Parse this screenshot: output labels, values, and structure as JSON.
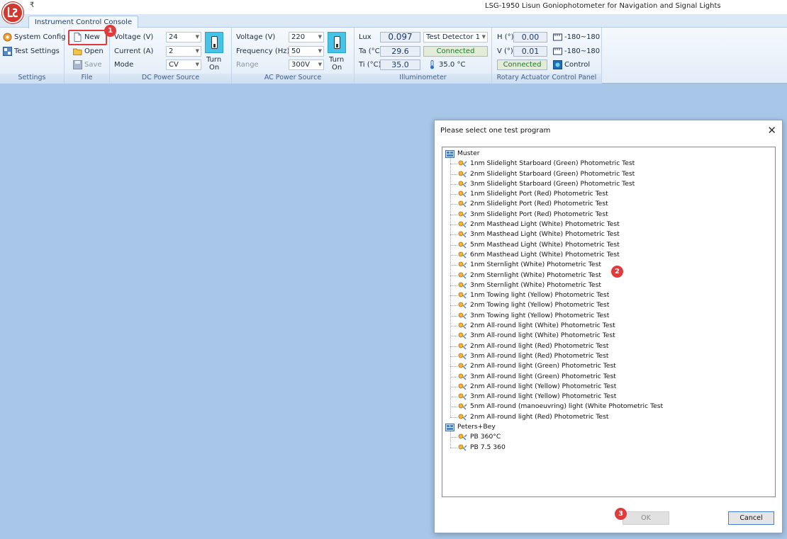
{
  "window": {
    "title": "LSG-1950 Lisun Goniophotometer for Navigation and Signal Lights",
    "qat_glyph": "₹",
    "active_tab": "Instrument Control Console"
  },
  "ribbon": {
    "settings": {
      "label": "Settings",
      "system_config": "System Config",
      "test_settings": "Test Settings"
    },
    "file": {
      "label": "File",
      "new": "New",
      "open": "Open",
      "save": "Save"
    },
    "dc_power": {
      "label": "DC Power Source",
      "voltage_label": "Voltage (V)",
      "voltage_value": "24",
      "current_label": "Current (A)",
      "current_value": "2",
      "mode_label": "Mode",
      "mode_value": "CV",
      "toggle_line1": "Turn",
      "toggle_line2": "On"
    },
    "ac_power": {
      "label": "AC Power Source",
      "voltage_label": "Voltage (V)",
      "voltage_value": "220",
      "frequency_label": "Frequency (Hz)",
      "frequency_value": "50",
      "range_label": "Range",
      "range_value": "300V",
      "toggle_line1": "Turn",
      "toggle_line2": "On"
    },
    "illuminometer": {
      "label": "Illuminometer",
      "lux_label": "Lux",
      "lux_value": "0.097",
      "ta_label": "Ta (°C)",
      "ta_value": "29.6",
      "ti_label": "Ti (°C)",
      "ti_value": "35.0",
      "detector_value": "Test Detector 1",
      "status": "Connected",
      "temp_reading": "35.0 °C"
    },
    "rotary": {
      "label": "Rotary Actuator Control Panel",
      "h_label": "H (°)",
      "h_value": "0.00",
      "h_range": "-180~180",
      "v_label": "V (°)",
      "v_value": "0.01",
      "v_range": "-180~180",
      "status": "Connected",
      "control": "Control"
    }
  },
  "annotations": {
    "step1": "1",
    "step2": "2",
    "step3": "3"
  },
  "dialog": {
    "title": "Please select one test program",
    "close_glyph": "✕",
    "groups": [
      {
        "name": "Muster",
        "items": [
          "1nm Slidelight Starboard (Green) Photometric Test",
          "2nm Slidelight Starboard (Green) Photometric Test",
          "3nm Slidelight Starboard (Green) Photometric Test",
          "1nm Slidelight Port (Red) Photometric Test",
          "2nm Slidelight Port (Red) Photometric Test",
          "3nm Slidelight Port (Red) Photometric Test",
          "2nm Masthead Light (White) Photometric Test",
          "3nm Masthead Light (White) Photometric Test",
          "5nm Masthead Light (White) Photometric Test",
          "6nm Masthead Light (White) Photometric Test",
          "1nm Sternlight  (White) Photometric Test",
          "2nm Sternlight  (White) Photometric Test",
          "3nm Sternlight  (White) Photometric Test",
          "1nm Towing light (Yellow) Photometric Test",
          "2nm Towing light (Yellow) Photometric Test",
          "3nm Towing light (Yellow) Photometric Test",
          "2nm All-round light (White) Photometric Test",
          "3nm All-round light (White) Photometric Test",
          "2nm All-round light (Red) Photometric Test",
          "3nm All-round light (Red) Photometric Test",
          "2nm All-round light (Green) Photometric Test",
          "3nm All-round light (Green) Photometric Test",
          "2nm All-round light (Yellow) Photometric Test",
          "3nm All-round light (Yellow) Photometric Test",
          "5nm All-round (manoeuvring) light (White Photometric Test",
          "2nm All-round light (Red) Photometric Test"
        ]
      },
      {
        "name": "Peters+Bey",
        "items": [
          "PB 360°C",
          "PB 7.5 360"
        ]
      }
    ],
    "ok_label": "OK",
    "cancel_label": "Cancel"
  }
}
